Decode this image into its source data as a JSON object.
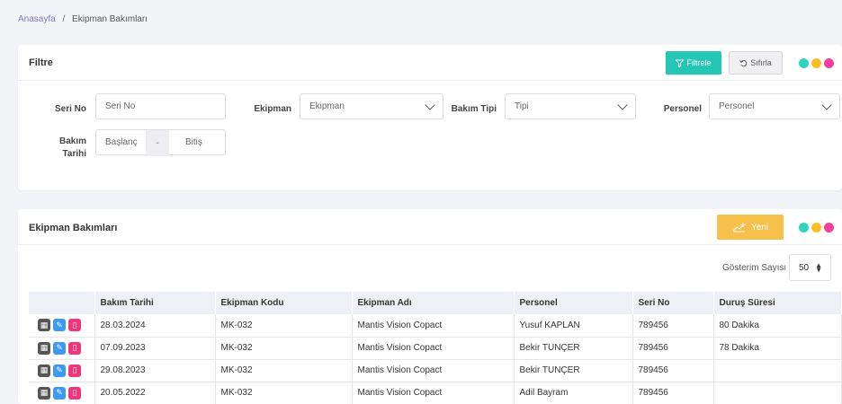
{
  "breadcrumb": {
    "home": "Anasayfa",
    "separator": "/",
    "current": "Ekipman Bakımları"
  },
  "filter_card": {
    "title": "Filtre",
    "filter_button": "Filtrele",
    "reset_button": "Sıfırla",
    "fields": {
      "serial_label": "Seri No",
      "serial_placeholder": "Seri No",
      "equipment_label": "Ekipman",
      "equipment_value": "Ekipman",
      "maintenance_type_label": "Bakım Tipi",
      "maintenance_type_value": "Tipi",
      "personnel_label": "Personel",
      "personnel_value": "Personel",
      "date_label_line1": "Bakım",
      "date_label_line2": "Tarihi",
      "date_start_placeholder": "Başlanç",
      "date_separator": "-",
      "date_end_placeholder": "Bitiş"
    }
  },
  "list_card": {
    "title": "Ekipman Bakımları",
    "new_button": "Yeni",
    "page_size_label": "Gösterim Sayısı",
    "page_size_value": "50",
    "columns": [
      "",
      "Bakım Tarihi",
      "Ekipman Kodu",
      "Ekipman Adı",
      "Personel",
      "Seri No",
      "Duruş Süresi"
    ],
    "rows": [
      {
        "date": "28.03.2024",
        "code": "MK-032",
        "name": "Mantis Vision Copact",
        "personnel": "Yusuf KAPLAN",
        "serial": "789456",
        "downtime": "80 Dakika"
      },
      {
        "date": "07.09.2023",
        "code": "MK-032",
        "name": "Mantis Vision Copact",
        "personnel": "Bekir TUNÇER",
        "serial": "789456",
        "downtime": "78 Dakika"
      },
      {
        "date": "29.08.2023",
        "code": "MK-032",
        "name": "Mantis Vision Copact",
        "personnel": "Bekir TUNÇER",
        "serial": "789456",
        "downtime": ""
      },
      {
        "date": "20.05.2022",
        "code": "MK-032",
        "name": "Mantis Vision Copact",
        "personnel": "Adil Bayram",
        "serial": "789456",
        "downtime": ""
      }
    ]
  },
  "colors": {
    "teal": "#26c6b6",
    "yellow": "#f7c04a",
    "pink": "#f0357a",
    "blue": "#3b9af6",
    "dot_teal": "#2dd4bf",
    "dot_yellow": "#fbbf24",
    "dot_pink": "#f43f9e"
  },
  "icons": {
    "filter_button": "funnel-icon",
    "reset_button": "undo-icon",
    "new_button": "add-icon",
    "row_actions": [
      "grid-icon",
      "edit-icon",
      "delete-icon"
    ]
  }
}
